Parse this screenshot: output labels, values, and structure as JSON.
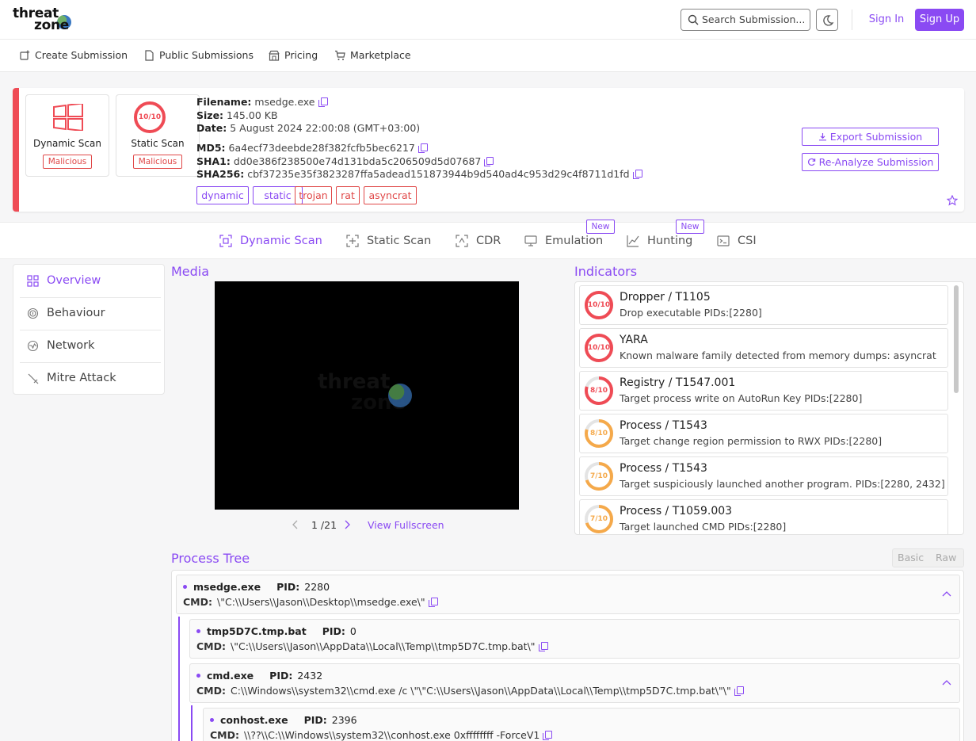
{
  "brand": {
    "line1": "threat",
    "line2": "zone"
  },
  "header": {
    "search_placeholder": "Search Submission...",
    "sign_in": "Sign In",
    "sign_up": "Sign Up"
  },
  "nav": {
    "items": [
      "Create Submission",
      "Public Submissions",
      "Pricing",
      "Marketplace"
    ]
  },
  "summary": {
    "dynamic_card": {
      "title": "Dynamic Scan",
      "verdict": "Malicious"
    },
    "static_card": {
      "title": "Static Scan",
      "score": "10/10",
      "verdict": "Malicious"
    },
    "filename_label": "Filename:",
    "filename": "msedge.exe",
    "size_label": "Size:",
    "size": "145.00 KB",
    "date_label": "Date:",
    "date": "5 August 2024 22:00:08 (GMT+03:00)",
    "md5_label": "MD5:",
    "md5": "6a4ecf73deebde28f382fcfb5bec6217",
    "sha1_label": "SHA1:",
    "sha1": "dd0e386f238500e74d131bda5c206509d5d07687",
    "sha256_label": "SHA256:",
    "sha256": "cbf37235e35f3823287ffa5adead151873944b9d540ad4c953d29c4f8711d1fd",
    "tags": [
      "dynamic",
      "static",
      "trojan",
      "rat",
      "asyncrat"
    ],
    "export_label": "Export Submission",
    "reanalyze_label": "Re-Analyze Submission"
  },
  "tabs": {
    "items": [
      "Dynamic Scan",
      "Static Scan",
      "CDR",
      "Emulation",
      "Hunting",
      "CSI"
    ],
    "new_badge": "New"
  },
  "sidebar": {
    "items": [
      "Overview",
      "Behaviour",
      "Network",
      "Mitre Attack"
    ]
  },
  "media": {
    "title": "Media",
    "page": "1 /21",
    "fullscreen": "View Fullscreen",
    "logo_line1": "threat",
    "logo_line2": "zone"
  },
  "indicators": {
    "title": "Indicators",
    "items": [
      {
        "score": "10/10",
        "name": "Dropper / T1105",
        "desc": "Drop executable PIDs:[2280]",
        "level": 1.0,
        "color": "#ef4b55"
      },
      {
        "score": "10/10",
        "name": "YARA",
        "desc": "Known malware family detected from memory dumps: asyncrat",
        "level": 1.0,
        "color": "#ef4b55"
      },
      {
        "score": "8/10",
        "name": "Registry / T1547.001",
        "desc": "Target process write on AutoRun Key PIDs:[2280]",
        "level": 0.8,
        "color": "#ef4b55"
      },
      {
        "score": "8/10",
        "name": "Process / T1543",
        "desc": "Target change region permission to RWX PIDs:[2280]",
        "level": 0.8,
        "color": "#f5a94a"
      },
      {
        "score": "7/10",
        "name": "Process / T1543",
        "desc": "Target suspiciously launched another program. PIDs:[2280, 2432]",
        "level": 0.7,
        "color": "#f5a94a"
      },
      {
        "score": "7/10",
        "name": "Process / T1059.003",
        "desc": "Target launched CMD PIDs:[2280]",
        "level": 0.7,
        "color": "#f5a94a"
      }
    ]
  },
  "process_tree": {
    "title": "Process Tree",
    "view_basic": "Basic",
    "view_raw": "Raw",
    "pid_label": "PID:",
    "cmd_label": "CMD:",
    "nodes": [
      {
        "name": "msedge.exe",
        "pid": "2280",
        "cmd": "\\\"C:\\\\Users\\\\Jason\\\\Desktop\\\\msedge.exe\\\""
      },
      {
        "name": "tmp5D7C.tmp.bat",
        "pid": "0",
        "cmd": "\\\"C:\\\\Users\\\\Jason\\\\AppData\\\\Local\\\\Temp\\\\tmp5D7C.tmp.bat\\\""
      },
      {
        "name": "cmd.exe",
        "pid": "2432",
        "cmd": "C:\\\\Windows\\\\system32\\\\cmd.exe /c \\\"\\\"C:\\\\Users\\\\Jason\\\\AppData\\\\Local\\\\Temp\\\\tmp5D7C.tmp.bat\\\"\\\""
      },
      {
        "name": "conhost.exe",
        "pid": "2396",
        "cmd": "\\\\??\\\\C:\\\\Windows\\\\system32\\\\conhost.exe 0xffffffff -ForceV1"
      }
    ]
  },
  "colors": {
    "accent": "#8a4af3",
    "danger": "#ef4b55",
    "warning": "#f5a94a"
  }
}
